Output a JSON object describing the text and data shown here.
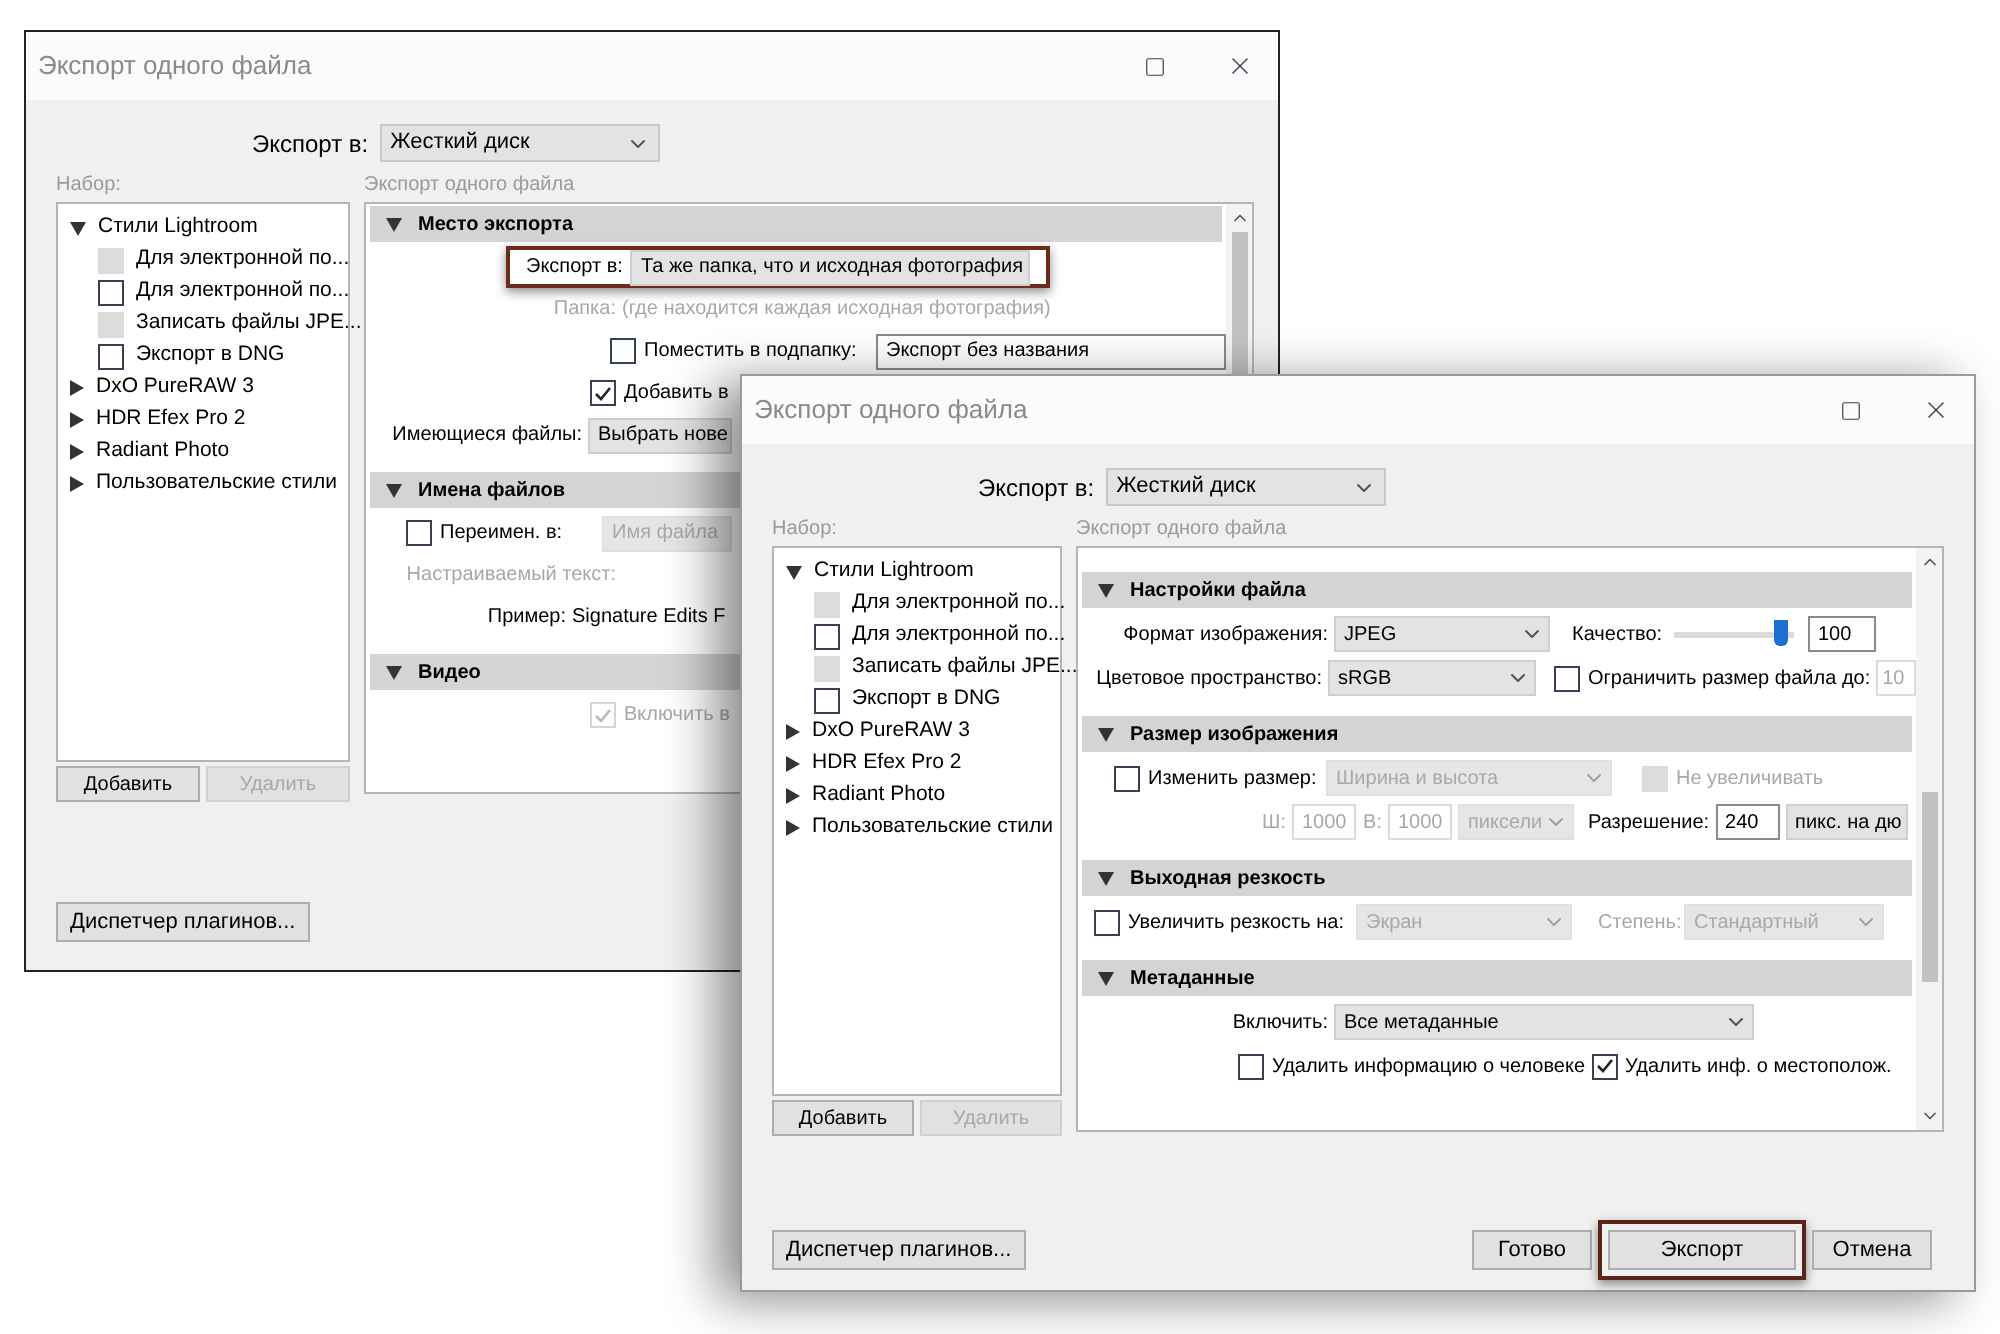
{
  "windows": [
    {
      "title": "Экспорт одного файла",
      "export_to": {
        "label": "Экспорт в:",
        "value": "Жесткий диск"
      },
      "preset_label": "Набор:",
      "presets": [
        {
          "label": "Стили Lightroom",
          "expanded": true,
          "children": [
            {
              "label": "Для электронной по...",
              "checked": false,
              "disabled": true
            },
            {
              "label": "Для электронной по...",
              "checked": false,
              "disabled": false
            },
            {
              "label": "Записать файлы JPE...",
              "checked": false,
              "disabled": true
            },
            {
              "label": "Экспорт в DNG",
              "checked": false,
              "disabled": false
            }
          ]
        },
        {
          "label": "DxO PureRAW 3",
          "expanded": false
        },
        {
          "label": "HDR Efex Pro 2",
          "expanded": false
        },
        {
          "label": "Radiant Photo",
          "expanded": false
        },
        {
          "label": "Пользовательские стили",
          "expanded": false
        }
      ],
      "preset_buttons": [
        {
          "label": "Добавить",
          "disabled": false
        },
        {
          "label": "Удалить",
          "disabled": true
        }
      ],
      "panel_label": "Экспорт одного файла",
      "sections": [
        {
          "title": "Место экспорта",
          "expanded": true,
          "rows": [
            {
              "highlighted": true,
              "items": [
                {
                  "kind": "label",
                  "text": "Экспорт в:",
                  "disabled": false
                },
                {
                  "kind": "field",
                  "value": "Та же папка, что и исходная фотография",
                  "disabled": false
                }
              ]
            },
            {
              "highlighted": false,
              "items": [
                {
                  "kind": "label",
                  "text": "Папка:",
                  "disabled": true
                },
                {
                  "kind": "text",
                  "text": "(где находится каждая исходная фотография)",
                  "disabled": true
                }
              ]
            },
            {
              "highlighted": false,
              "items": [
                {
                  "kind": "checkbox",
                  "label": "Поместить в подпапку:",
                  "checked": false,
                  "disabled": false
                },
                {
                  "kind": "input",
                  "value": "Экспорт без названия",
                  "disabled": false
                }
              ]
            },
            {
              "highlighted": false,
              "items": [
                {
                  "kind": "checkbox",
                  "label": "Добавить в",
                  "checked": true,
                  "disabled": false
                }
              ]
            },
            {
              "highlighted": false,
              "items": [
                {
                  "kind": "label",
                  "text": "Имеющиеся файлы:",
                  "disabled": false
                },
                {
                  "kind": "field",
                  "value": "Выбрать нове",
                  "disabled": false
                }
              ]
            }
          ]
        },
        {
          "title": "Имена файлов",
          "expanded": true,
          "rows": [
            {
              "highlighted": false,
              "items": [
                {
                  "kind": "checkbox",
                  "label": "Переимен. в:",
                  "checked": false,
                  "disabled": false
                },
                {
                  "kind": "field",
                  "value": "Имя файла",
                  "disabled": true
                }
              ]
            },
            {
              "highlighted": false,
              "items": [
                {
                  "kind": "label",
                  "text": "Настраиваемый текст:",
                  "disabled": true
                }
              ]
            },
            {
              "highlighted": false,
              "items": [
                {
                  "kind": "label",
                  "text": "Пример:",
                  "disabled": false
                },
                {
                  "kind": "text",
                  "text": "Signature Edits F",
                  "disabled": false
                }
              ]
            }
          ]
        },
        {
          "title": "Видео",
          "expanded": true,
          "rows": [
            {
              "highlighted": false,
              "items": [
                {
                  "kind": "checkbox",
                  "label": "Включить в",
                  "checked": true,
                  "disabled": true
                }
              ]
            }
          ]
        }
      ],
      "plugin_button": "Диспетчер плагинов..."
    },
    {
      "title": "Экспорт одного файла",
      "export_to": {
        "label": "Экспорт в:",
        "value": "Жесткий диск"
      },
      "preset_label": "Набор:",
      "presets": [
        {
          "label": "Стили Lightroom",
          "expanded": true,
          "children": [
            {
              "label": "Для электронной по...",
              "checked": false,
              "disabled": true
            },
            {
              "label": "Для электронной по...",
              "checked": false,
              "disabled": false
            },
            {
              "label": "Записать файлы JPE...",
              "checked": false,
              "disabled": true
            },
            {
              "label": "Экспорт в DNG",
              "checked": false,
              "disabled": false
            }
          ]
        },
        {
          "label": "DxO PureRAW 3",
          "expanded": false
        },
        {
          "label": "HDR Efex Pro 2",
          "expanded": false
        },
        {
          "label": "Radiant Photo",
          "expanded": false
        },
        {
          "label": "Пользовательские стили",
          "expanded": false
        }
      ],
      "preset_buttons": [
        {
          "label": "Добавить",
          "disabled": false
        },
        {
          "label": "Удалить",
          "disabled": true
        }
      ],
      "panel_label": "Экспорт одного файла",
      "sections": [
        {
          "title": "Настройки файла",
          "expanded": true,
          "rows": [
            {
              "highlighted": false,
              "items": [
                {
                  "kind": "label",
                  "text": "Формат изображения:",
                  "disabled": false
                },
                {
                  "kind": "select",
                  "value": "JPEG",
                  "disabled": false
                },
                {
                  "kind": "text",
                  "text": "Качество:",
                  "disabled": false
                },
                {
                  "kind": "slider",
                  "level": 0.9
                },
                {
                  "kind": "input",
                  "value": "100",
                  "disabled": false
                }
              ]
            },
            {
              "highlighted": false,
              "items": [
                {
                  "kind": "label",
                  "text": "Цветовое пространство:",
                  "disabled": false
                },
                {
                  "kind": "select",
                  "value": "sRGB",
                  "disabled": false
                },
                {
                  "kind": "checkbox",
                  "label": "Ограничить размер файла до:",
                  "checked": false,
                  "disabled": false
                },
                {
                  "kind": "input",
                  "value": "10",
                  "disabled": true
                }
              ]
            }
          ]
        },
        {
          "title": "Размер изображения",
          "expanded": true,
          "rows": [
            {
              "highlighted": false,
              "items": [
                {
                  "kind": "checkbox",
                  "label": "Изменить размер:",
                  "checked": false,
                  "disabled": false
                },
                {
                  "kind": "select",
                  "value": "Ширина и высота",
                  "disabled": true
                },
                {
                  "kind": "checkbox",
                  "label": "Не увеличивать",
                  "checked": false,
                  "disabled": true
                }
              ]
            },
            {
              "highlighted": false,
              "items": [
                {
                  "kind": "label",
                  "text": "Ш:",
                  "disabled": true
                },
                {
                  "kind": "input",
                  "value": "1000",
                  "disabled": true
                },
                {
                  "kind": "label",
                  "text": "В:",
                  "disabled": true
                },
                {
                  "kind": "input",
                  "value": "1000",
                  "disabled": true
                },
                {
                  "kind": "select",
                  "value": "пиксели",
                  "disabled": true
                },
                {
                  "kind": "text",
                  "text": "Разрешение:",
                  "disabled": false
                },
                {
                  "kind": "input",
                  "value": "240",
                  "disabled": false
                },
                {
                  "kind": "field",
                  "value": "пикс. на дю",
                  "disabled": false
                }
              ]
            }
          ]
        },
        {
          "title": "Выходная резкость",
          "expanded": true,
          "rows": [
            {
              "highlighted": false,
              "items": [
                {
                  "kind": "checkbox",
                  "label": "Увеличить резкость на:",
                  "checked": false,
                  "disabled": false
                },
                {
                  "kind": "select",
                  "value": "Экран",
                  "disabled": true
                },
                {
                  "kind": "label",
                  "text": "Степень:",
                  "disabled": true
                },
                {
                  "kind": "select",
                  "value": "Стандартный",
                  "disabled": true
                }
              ]
            }
          ]
        },
        {
          "title": "Метаданные",
          "expanded": true,
          "rows": [
            {
              "highlighted": false,
              "items": [
                {
                  "kind": "label",
                  "text": "Включить:",
                  "disabled": false
                },
                {
                  "kind": "select",
                  "value": "Все метаданные",
                  "disabled": false
                }
              ]
            },
            {
              "highlighted": false,
              "items": [
                {
                  "kind": "checkbox",
                  "label": "Удалить информацию о человеке",
                  "checked": false,
                  "disabled": false
                },
                {
                  "kind": "checkbox",
                  "label": "Удалить инф. о местополож.",
                  "checked": true,
                  "disabled": false
                }
              ]
            }
          ]
        }
      ],
      "plugin_button": "Диспетчер плагинов...",
      "footer_buttons": [
        {
          "label": "Готово",
          "highlighted": false
        },
        {
          "label": "Экспорт",
          "highlighted": true
        },
        {
          "label": "Отмена",
          "highlighted": false
        }
      ]
    }
  ]
}
